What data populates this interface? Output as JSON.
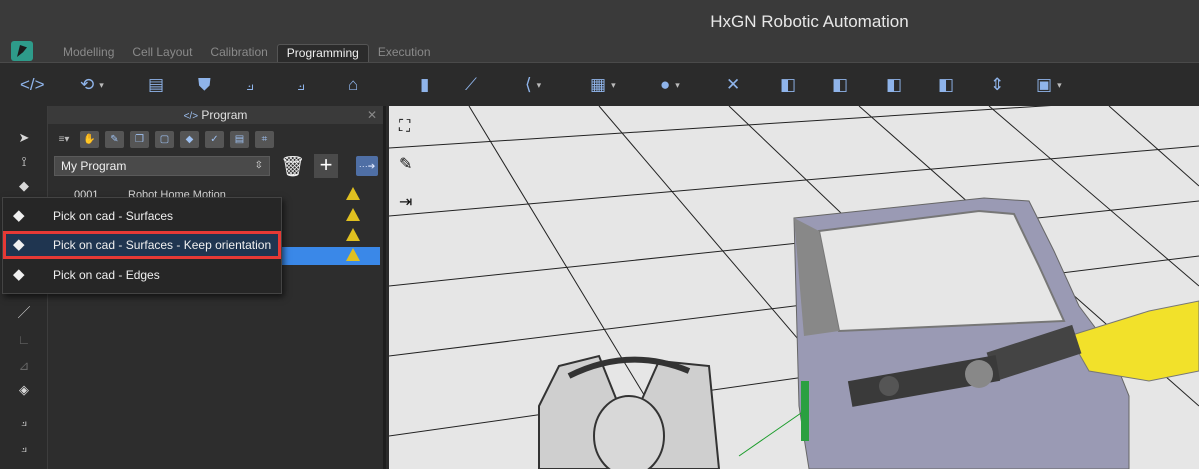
{
  "app": {
    "title": "HxGN Robotic Automation"
  },
  "tabs": [
    {
      "label": "Modelling"
    },
    {
      "label": "Cell Layout"
    },
    {
      "label": "Calibration"
    },
    {
      "label": "Programming"
    },
    {
      "label": "Execution"
    }
  ],
  "toolbar": {
    "icons": [
      "code-icon",
      "rotate-icon",
      "list-icon",
      "shield-icon",
      "robot-arm-icon",
      "robot-arm-2-icon",
      "robot-home-icon",
      "tool-probe-icon",
      "arm-path-icon",
      "arm-segment-icon",
      "window-icon",
      "camera-icon",
      "collision-icon",
      "target-play-icon",
      "target-add-icon",
      "target-rotate-icon",
      "target-lock-icon",
      "sensor-icon",
      "screen-icon"
    ]
  },
  "panel": {
    "title": "Program",
    "program_name": "My Program",
    "rows": [
      {
        "num": "0001",
        "name": "Robot Home Motion"
      },
      {
        "num": "",
        "name": ""
      },
      {
        "num": "",
        "name": ""
      },
      {
        "num": "",
        "name": ""
      }
    ]
  },
  "popup": {
    "items": [
      {
        "label": "Pick on cad - Surfaces"
      },
      {
        "label": "Pick on cad - Surfaces - Keep orientation"
      },
      {
        "label": "Pick on cad - Edges"
      }
    ]
  },
  "colors": {
    "accent": "#3a88e8",
    "highlight_border": "#e53935",
    "robot_yellow": "#f2e12a",
    "door_color": "#9a9ab4"
  }
}
